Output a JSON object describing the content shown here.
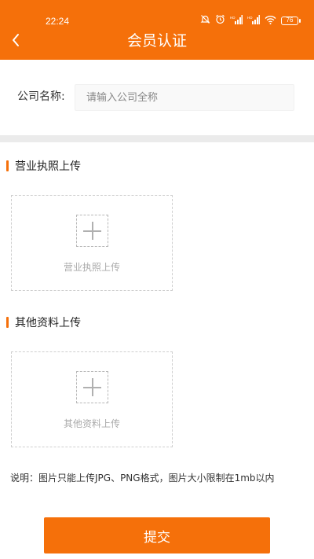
{
  "status_bar": {
    "time": "22:24",
    "battery": "76",
    "icons": [
      "mute-icon",
      "alarm-icon",
      "signal-icon",
      "signal-icon",
      "wifi-icon",
      "battery-icon"
    ]
  },
  "nav": {
    "title": "会员认证",
    "back_icon": "chevron-left-icon"
  },
  "company": {
    "label": "公司名称:",
    "value": "",
    "placeholder": "请输入公司全称"
  },
  "sections": [
    {
      "title": "营业执照上传",
      "upload_label": "营业执照上传",
      "icon": "add-icon"
    },
    {
      "title": "其他资料上传",
      "upload_label": "其他资料上传",
      "icon": "add-icon"
    }
  ],
  "note": "说明：图片只能上传JPG、PNG格式，图片大小限制在1mb以内",
  "submit_label": "提交",
  "colors": {
    "accent": "#f5700a",
    "divider": "#ebebeb",
    "placeholder": "#aaaaaa"
  }
}
